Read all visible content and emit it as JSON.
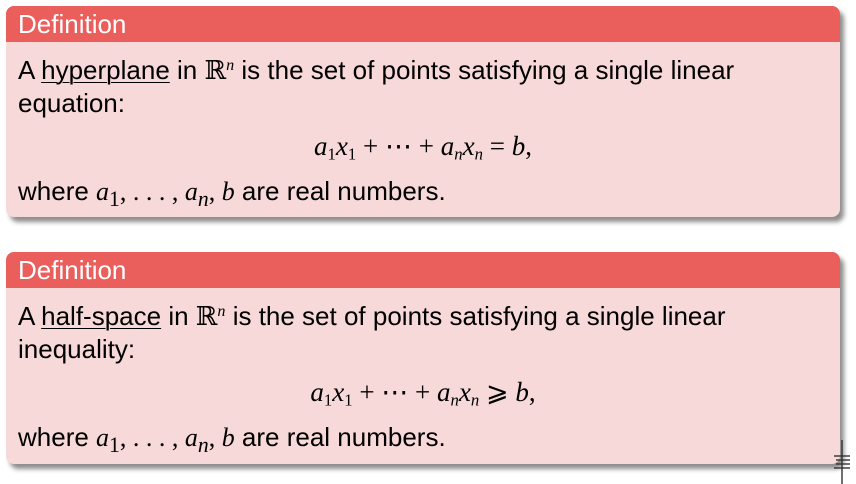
{
  "definitions": [
    {
      "title": "Definition",
      "intro_before": "A ",
      "term": "hyperplane",
      "intro_in": " in ",
      "space": "ℝ",
      "space_exp": "n",
      "intro_after": " is the set of points satisfying a single linear equation:",
      "display": {
        "a1": "a",
        "s1": "1",
        "x1": "x",
        "t1": "1",
        "plus_dots_plus": " + ⋯ + ",
        "an": "a",
        "sn": "n",
        "xn": "x",
        "tn": "n",
        "relation": " = ",
        "rhs": "b",
        "end": ","
      },
      "where_before": "where ",
      "where_vars": {
        "a": "a",
        "one": "1",
        "dots": ", . . . , ",
        "a2": "a",
        "n": "n",
        "comma": ", ",
        "b": "b"
      },
      "where_after": " are real numbers."
    },
    {
      "title": "Definition",
      "intro_before": "A ",
      "term": "half-space",
      "intro_in": " in ",
      "space": "ℝ",
      "space_exp": "n",
      "intro_after": " is the set of points satisfying a single linear inequality:",
      "display": {
        "a1": "a",
        "s1": "1",
        "x1": "x",
        "t1": "1",
        "plus_dots_plus": " + ⋯ + ",
        "an": "a",
        "sn": "n",
        "xn": "x",
        "tn": "n",
        "relation": " ⩾ ",
        "rhs": "b",
        "end": ","
      },
      "where_before": "where ",
      "where_vars": {
        "a": "a",
        "one": "1",
        "dots": ", . . . , ",
        "a2": "a",
        "n": "n",
        "comma": ", ",
        "b": "b"
      },
      "where_after": " are real numbers."
    }
  ]
}
